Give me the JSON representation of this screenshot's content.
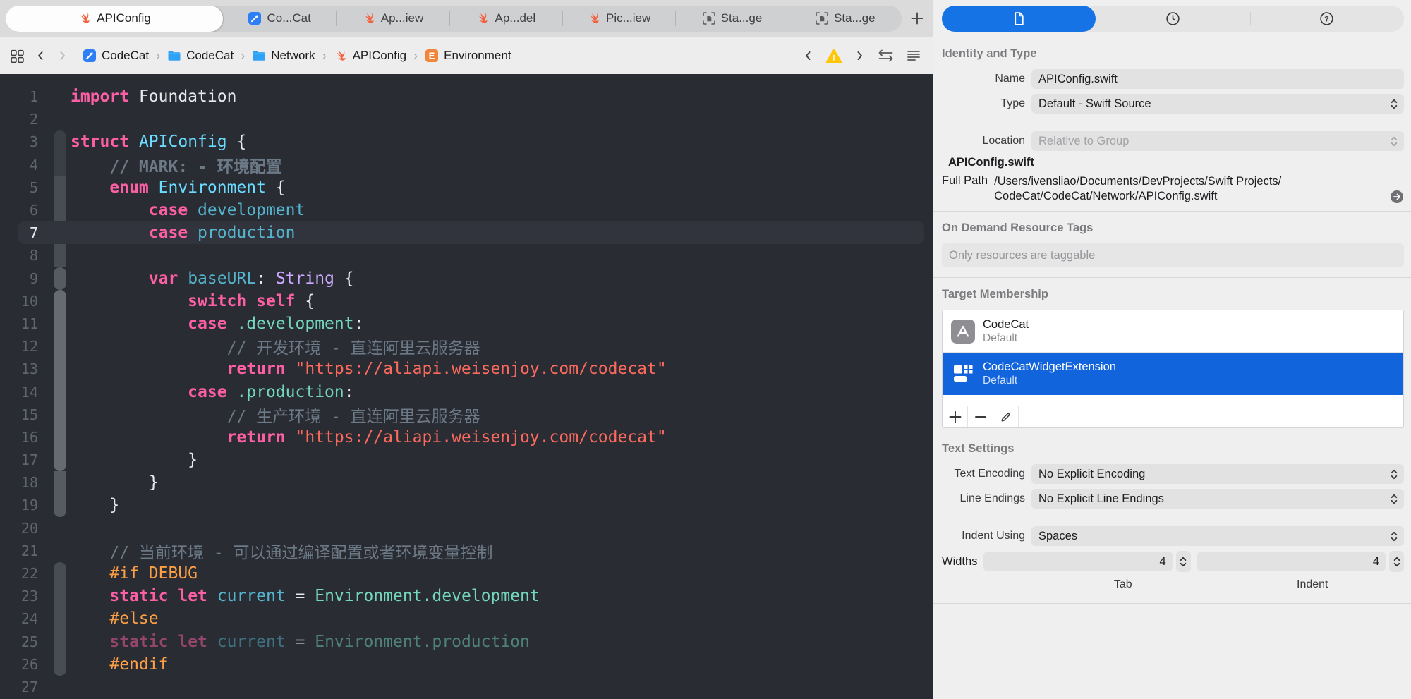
{
  "colors": {
    "accent_blue": "#1673e6",
    "selection_blue": "#1164dc",
    "warning_yellow": "#ffc60a",
    "editor_background": "#292c33",
    "keyword_pink": "#fc5fa3",
    "type_cyan": "#6bdbff",
    "member_teal": "#74d6ba",
    "string_red": "#fc6a5d",
    "comment_gray": "#6c7986",
    "preprocessor_orange": "#fd9f45"
  },
  "tab_bar": {
    "tabs": [
      {
        "label": "APIConfig",
        "icon": "swift",
        "active": true
      },
      {
        "label": "Co...Cat",
        "icon": "app",
        "active": false
      },
      {
        "label": "Ap...iew",
        "icon": "swift",
        "active": false
      },
      {
        "label": "Ap...del",
        "icon": "swift",
        "active": false
      },
      {
        "label": "Pic...iew",
        "icon": "swift",
        "active": false
      },
      {
        "label": "Sta...ge",
        "icon": "export",
        "active": false
      },
      {
        "label": "Sta...ge",
        "icon": "export",
        "active": false
      }
    ]
  },
  "breadcrumb": {
    "separator": "›",
    "items": [
      {
        "icon": "app",
        "label": "CodeCat"
      },
      {
        "icon": "folder",
        "label": "CodeCat"
      },
      {
        "icon": "folder",
        "label": "Network"
      },
      {
        "icon": "swift",
        "label": "APIConfig"
      },
      {
        "icon": "enumE",
        "label": "Environment"
      }
    ]
  },
  "editor": {
    "lines": [
      {
        "n": "1",
        "segs": [
          [
            "kw",
            "import"
          ],
          [
            "pln",
            " Foundation"
          ]
        ]
      },
      {
        "n": "2",
        "segs": []
      },
      {
        "n": "3",
        "segs": [
          [
            "kw",
            "struct"
          ],
          [
            "pln",
            " "
          ],
          [
            "type",
            "APIConfig"
          ],
          [
            "pln",
            " {"
          ]
        ]
      },
      {
        "n": "4",
        "segs": [
          [
            "pln",
            "    "
          ],
          [
            "cmtb",
            "// MARK: - 环境配置"
          ]
        ]
      },
      {
        "n": "5",
        "segs": [
          [
            "pln",
            "    "
          ],
          [
            "kw",
            "enum"
          ],
          [
            "pln",
            " "
          ],
          [
            "type",
            "Environment"
          ],
          [
            "pln",
            " {"
          ]
        ]
      },
      {
        "n": "6",
        "segs": [
          [
            "pln",
            "        "
          ],
          [
            "kw",
            "case"
          ],
          [
            "pln",
            " "
          ],
          [
            "name",
            "development"
          ]
        ]
      },
      {
        "n": "7",
        "current": true,
        "segs": [
          [
            "pln",
            "        "
          ],
          [
            "kw",
            "case"
          ],
          [
            "pln",
            " "
          ],
          [
            "name",
            "production"
          ]
        ]
      },
      {
        "n": "8",
        "segs": []
      },
      {
        "n": "9",
        "segs": [
          [
            "pln",
            "        "
          ],
          [
            "kw",
            "var"
          ],
          [
            "pln",
            " "
          ],
          [
            "name",
            "baseURL"
          ],
          [
            "pln",
            ": "
          ],
          [
            "typep",
            "String"
          ],
          [
            "pln",
            " {"
          ]
        ]
      },
      {
        "n": "10",
        "segs": [
          [
            "pln",
            "            "
          ],
          [
            "kw",
            "switch"
          ],
          [
            "pln",
            " "
          ],
          [
            "kw",
            "self"
          ],
          [
            "pln",
            " {"
          ]
        ]
      },
      {
        "n": "11",
        "segs": [
          [
            "pln",
            "            "
          ],
          [
            "kw",
            "case"
          ],
          [
            "pln",
            " "
          ],
          [
            "ref",
            ".development"
          ],
          [
            "pln",
            ":"
          ]
        ]
      },
      {
        "n": "12",
        "segs": [
          [
            "pln",
            "                "
          ],
          [
            "cmt",
            "// 开发环境 - 直连阿里云服务器"
          ]
        ]
      },
      {
        "n": "13",
        "segs": [
          [
            "pln",
            "                "
          ],
          [
            "kw",
            "return"
          ],
          [
            "pln",
            " "
          ],
          [
            "str",
            "\"https://aliapi.weisenjoy.com/codecat\""
          ]
        ]
      },
      {
        "n": "14",
        "segs": [
          [
            "pln",
            "            "
          ],
          [
            "kw",
            "case"
          ],
          [
            "pln",
            " "
          ],
          [
            "ref",
            ".production"
          ],
          [
            "pln",
            ":"
          ]
        ]
      },
      {
        "n": "15",
        "segs": [
          [
            "pln",
            "                "
          ],
          [
            "cmt",
            "// 生产环境 - 直连阿里云服务器"
          ]
        ]
      },
      {
        "n": "16",
        "segs": [
          [
            "pln",
            "                "
          ],
          [
            "kw",
            "return"
          ],
          [
            "pln",
            " "
          ],
          [
            "str",
            "\"https://aliapi.weisenjoy.com/codecat\""
          ]
        ]
      },
      {
        "n": "17",
        "segs": [
          [
            "pln",
            "            }"
          ]
        ]
      },
      {
        "n": "18",
        "segs": [
          [
            "pln",
            "        }"
          ]
        ]
      },
      {
        "n": "19",
        "segs": [
          [
            "pln",
            "    }"
          ]
        ]
      },
      {
        "n": "20",
        "segs": []
      },
      {
        "n": "21",
        "segs": [
          [
            "pln",
            "    "
          ],
          [
            "cmt",
            "// 当前环境 - 可以通过编译配置或者环境变量控制"
          ]
        ]
      },
      {
        "n": "22",
        "segs": [
          [
            "pln",
            "    "
          ],
          [
            "pre",
            "#if DEBUG"
          ]
        ]
      },
      {
        "n": "23",
        "segs": [
          [
            "pln",
            "    "
          ],
          [
            "kw",
            "static"
          ],
          [
            "pln",
            " "
          ],
          [
            "kw",
            "let"
          ],
          [
            "pln",
            " "
          ],
          [
            "name",
            "current"
          ],
          [
            "pln",
            " = "
          ],
          [
            "ref",
            "Environment.development"
          ]
        ]
      },
      {
        "n": "24",
        "segs": [
          [
            "pln",
            "    "
          ],
          [
            "pre",
            "#else"
          ]
        ]
      },
      {
        "n": "25",
        "dim": true,
        "segs": [
          [
            "pln",
            "    "
          ],
          [
            "kw",
            "static"
          ],
          [
            "pln",
            " "
          ],
          [
            "kw",
            "let"
          ],
          [
            "pln",
            " "
          ],
          [
            "name",
            "current"
          ],
          [
            "pln",
            " = "
          ],
          [
            "ref",
            "Environment.production"
          ]
        ]
      },
      {
        "n": "26",
        "segs": [
          [
            "pln",
            "    "
          ],
          [
            "pre",
            "#endif"
          ]
        ]
      },
      {
        "n": "27",
        "segs": []
      }
    ],
    "fold_segments": [
      {
        "from": 3,
        "to": 4,
        "color": "#3a3e45",
        "round": "top"
      },
      {
        "from": 5,
        "to": 8,
        "color": "#484c53",
        "round": "none"
      },
      {
        "from": 9,
        "to": 9,
        "color": "#565a61",
        "round": "both"
      },
      {
        "from": 10,
        "to": 17,
        "color": "#666a71",
        "round": "both"
      },
      {
        "from": 18,
        "to": 19,
        "color": "#565a61",
        "round": "bottom"
      },
      {
        "from": 22,
        "to": 26,
        "color": "#484c53",
        "round": "both"
      }
    ]
  },
  "inspector": {
    "tabs": [
      {
        "name": "file-inspector",
        "icon": "doc",
        "selected": true
      },
      {
        "name": "history-inspector",
        "icon": "clock",
        "selected": false
      },
      {
        "name": "quick-help-inspector",
        "icon": "help",
        "selected": false
      }
    ],
    "identity": {
      "header": "Identity and Type",
      "name_label": "Name",
      "name_value": "APIConfig.swift",
      "type_label": "Type",
      "type_value": "Default - Swift Source",
      "location_label": "Location",
      "location_value": "Relative to Group",
      "filename": "APIConfig.swift",
      "full_path_label": "Full Path",
      "full_path_line1": "/Users/ivensliao/Documents/DevProjects/Swift Projects/",
      "full_path_line2": "CodeCat/CodeCat/Network/APIConfig.swift"
    },
    "resource_tags": {
      "header": "On Demand Resource Tags",
      "placeholder": "Only resources are taggable"
    },
    "target_membership": {
      "header": "Target Membership",
      "rows": [
        {
          "icon": "appstore",
          "name": "CodeCat",
          "subtitle": "Default",
          "selected": false
        },
        {
          "icon": "widget",
          "name": "CodeCatWidgetExtension",
          "subtitle": "Default",
          "selected": true
        }
      ]
    },
    "text_settings": {
      "header": "Text Settings",
      "encoding_label": "Text Encoding",
      "encoding_value": "No Explicit Encoding",
      "line_endings_label": "Line Endings",
      "line_endings_value": "No Explicit Line Endings",
      "indent_label": "Indent Using",
      "indent_value": "Spaces",
      "widths_label": "Widths",
      "tab_width": "4",
      "indent_width": "4",
      "tab_caption": "Tab",
      "indent_caption": "Indent"
    }
  }
}
